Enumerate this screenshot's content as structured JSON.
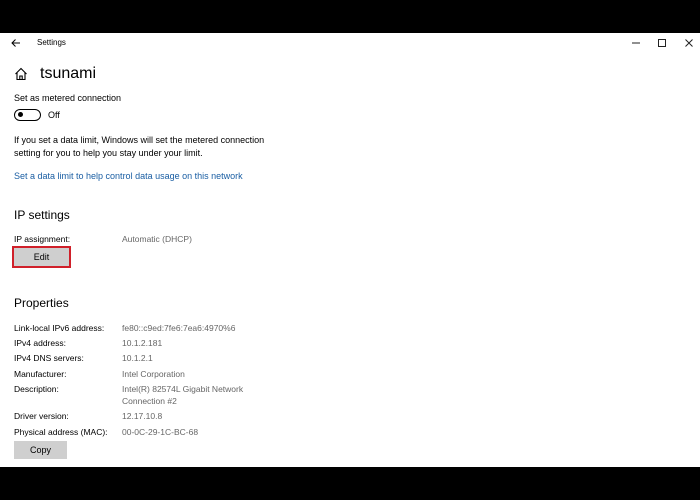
{
  "titlebar": {
    "app_title": "Settings",
    "back_icon": "arrow-left-icon",
    "minimize_icon": "minimize-icon",
    "maximize_icon": "maximize-icon",
    "close_icon": "close-icon"
  },
  "header": {
    "home_icon": "home-icon",
    "title": "tsunami"
  },
  "metered": {
    "label": "Set as metered connection",
    "toggle_state": "Off",
    "toggle_on": false,
    "info": "If you set a data limit, Windows will set the metered connection setting for you to help you stay under your limit.",
    "link": "Set a data limit to help control data usage on this network"
  },
  "ip_settings": {
    "heading": "IP settings",
    "assignment_label": "IP assignment:",
    "assignment_value": "Automatic (DHCP)",
    "edit_label": "Edit"
  },
  "properties": {
    "heading": "Properties",
    "rows": [
      {
        "label": "Link-local IPv6 address:",
        "value": "fe80::c9ed:7fe6:7ea6:4970%6"
      },
      {
        "label": "IPv4 address:",
        "value": "10.1.2.181"
      },
      {
        "label": "IPv4 DNS servers:",
        "value": "10.1.2.1"
      },
      {
        "label": "Manufacturer:",
        "value": "Intel Corporation"
      },
      {
        "label": "Description:",
        "value_line1": "Intel(R) 82574L Gigabit Network",
        "value_line2": "Connection #2"
      },
      {
        "label": "Driver version:",
        "value": "12.17.10.8"
      },
      {
        "label": "Physical address (MAC):",
        "value": "00-0C-29-1C-BC-68"
      }
    ],
    "copy_label": "Copy"
  },
  "colors": {
    "link": "#1a5ea3",
    "highlight": "#d0202a",
    "button_bg": "#cfcfcf"
  }
}
